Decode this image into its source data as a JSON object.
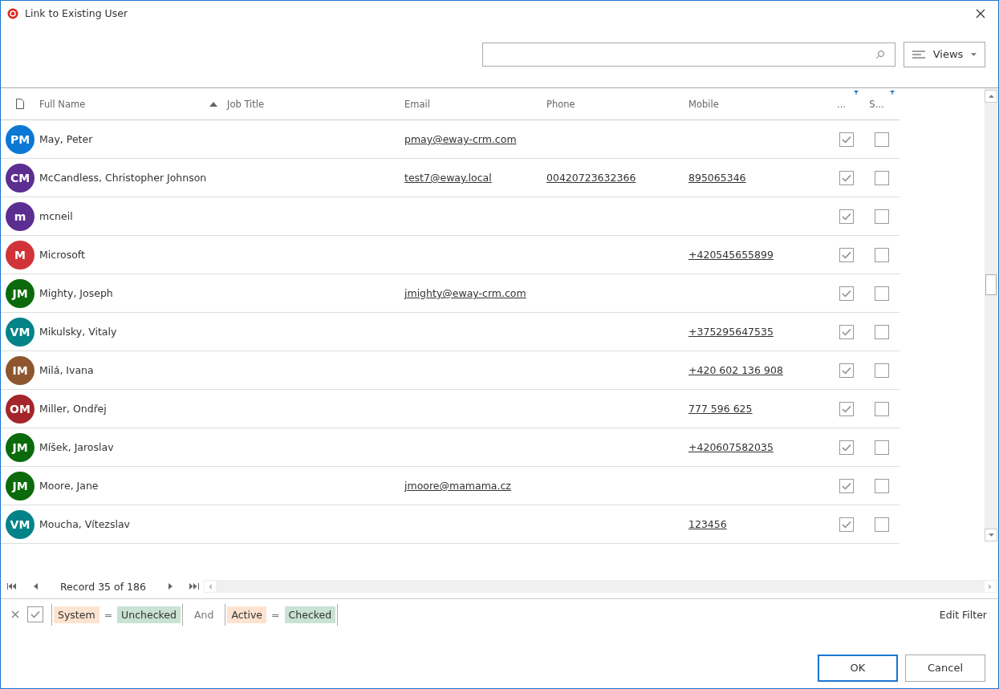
{
  "window": {
    "title": "Link to Existing User"
  },
  "views_button": "Views",
  "table": {
    "columns": [
      "Full Name",
      "Job Title",
      "Email",
      "Phone",
      "Mobile",
      "...",
      "S..."
    ],
    "rows": [
      {
        "initials": "PM",
        "color": "#0a78d4",
        "name": "May, Peter",
        "job_title": "",
        "email": "pmay@eway-crm.com",
        "phone": "",
        "mobile": "",
        "active": true,
        "system": false
      },
      {
        "initials": "CM",
        "color": "#5c2e91",
        "name": "McCandless, Christopher Johnson",
        "job_title": "",
        "email": "test7@eway.local",
        "phone": "00420723632366",
        "mobile": "895065346",
        "active": true,
        "system": false
      },
      {
        "initials": "m",
        "color": "#5c2e91",
        "name": "mcneil",
        "job_title": "",
        "email": "",
        "phone": "",
        "mobile": "",
        "active": true,
        "system": false
      },
      {
        "initials": "M",
        "color": "#d13438",
        "name": "Microsoft",
        "job_title": "",
        "email": "",
        "phone": "",
        "mobile": "+420545655899",
        "active": true,
        "system": false
      },
      {
        "initials": "JM",
        "color": "#0b6a0b",
        "name": "Mighty, Joseph",
        "job_title": "",
        "email": "jmighty@eway-crm.com",
        "phone": "",
        "mobile": "",
        "active": true,
        "system": false
      },
      {
        "initials": "VM",
        "color": "#038387",
        "name": "Mikulsky, Vitaly",
        "job_title": "",
        "email": "",
        "phone": "",
        "mobile": "+375295647535",
        "active": true,
        "system": false
      },
      {
        "initials": "IM",
        "color": "#8e562e",
        "name": "Milá, Ivana",
        "job_title": "",
        "email": "",
        "phone": "",
        "mobile": "+420 602 136 908",
        "active": true,
        "system": false
      },
      {
        "initials": "OM",
        "color": "#a4262c",
        "name": "Miller, Ondřej",
        "job_title": "",
        "email": "",
        "phone": "",
        "mobile": "777 596 625",
        "active": true,
        "system": false
      },
      {
        "initials": "JM",
        "color": "#0b6a0b",
        "name": "Míšek, Jaroslav",
        "job_title": "",
        "email": "",
        "phone": "",
        "mobile": "+420607582035",
        "active": true,
        "system": false
      },
      {
        "initials": "JM",
        "color": "#0b6a0b",
        "name": "Moore, Jane",
        "job_title": "",
        "email": "jmoore@mamama.cz",
        "phone": "",
        "mobile": "",
        "active": true,
        "system": false
      },
      {
        "initials": "VM",
        "color": "#038387",
        "name": "Moucha, Vítezslav",
        "job_title": "",
        "email": "",
        "phone": "",
        "mobile": "123456",
        "active": true,
        "system": false
      }
    ]
  },
  "pager": {
    "text": "Record 35 of 186"
  },
  "filter": {
    "enabled": true,
    "groups": [
      {
        "field": "System",
        "operator": "=",
        "value": "Unchecked"
      },
      {
        "field": "Active",
        "operator": "=",
        "value": "Checked"
      }
    ],
    "conjunction": "And",
    "edit_link": "Edit Filter"
  },
  "buttons": [
    "OK",
    "Cancel"
  ]
}
